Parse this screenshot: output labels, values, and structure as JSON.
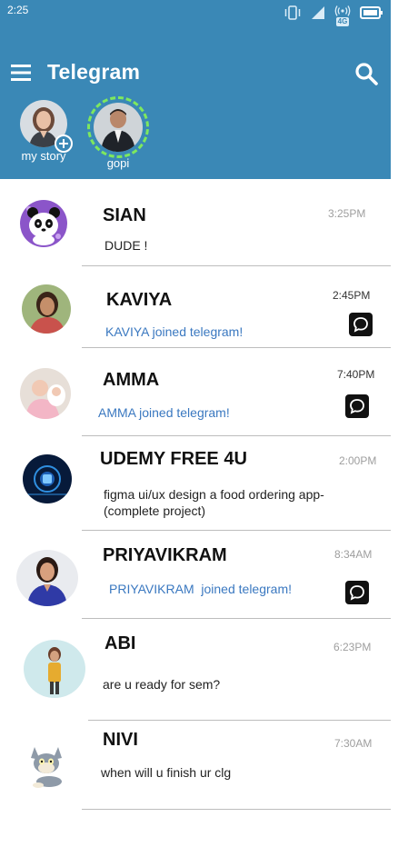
{
  "status_bar": {
    "time": "2:25",
    "network_label": "4G"
  },
  "header": {
    "title": "Telegram",
    "menu_icon": "hamburger-menu-icon",
    "search_icon": "search-icon",
    "background_color": "#3a88b6"
  },
  "stories": [
    {
      "label": "my story",
      "has_add_badge": true
    },
    {
      "label": "gopi",
      "ring_color": "#7ee85e"
    }
  ],
  "chats": [
    {
      "name": "SIAN",
      "time": "3:25PM",
      "message": "DUDE !",
      "message_style": "normal",
      "unread_icon": false
    },
    {
      "name": "KAVIYA",
      "time": "2:45PM",
      "message": "KAVIYA joined telegram!",
      "message_style": "joined",
      "unread_icon": true
    },
    {
      "name": "AMMA",
      "time": "7:40PM",
      "message": "AMMA joined telegram!",
      "message_style": "joined",
      "unread_icon": true
    },
    {
      "name": "UDEMY FREE 4U",
      "time": "2:00PM",
      "message": "figma ui/ux design a food ordering app-(complete project)",
      "message_style": "normal",
      "unread_icon": false
    },
    {
      "name": "PRIYAVIKRAM",
      "time": "8:34AM",
      "message": "PRIYAVIKRAM  joined telegram!",
      "message_style": "joined",
      "unread_icon": true
    },
    {
      "name": "ABI",
      "time": "6:23PM",
      "message": "are u ready for sem?",
      "message_style": "normal",
      "unread_icon": false
    },
    {
      "name": "NIVI",
      "time": "7:30AM",
      "message": "when will u finish ur clg",
      "message_style": "normal",
      "unread_icon": false
    }
  ]
}
